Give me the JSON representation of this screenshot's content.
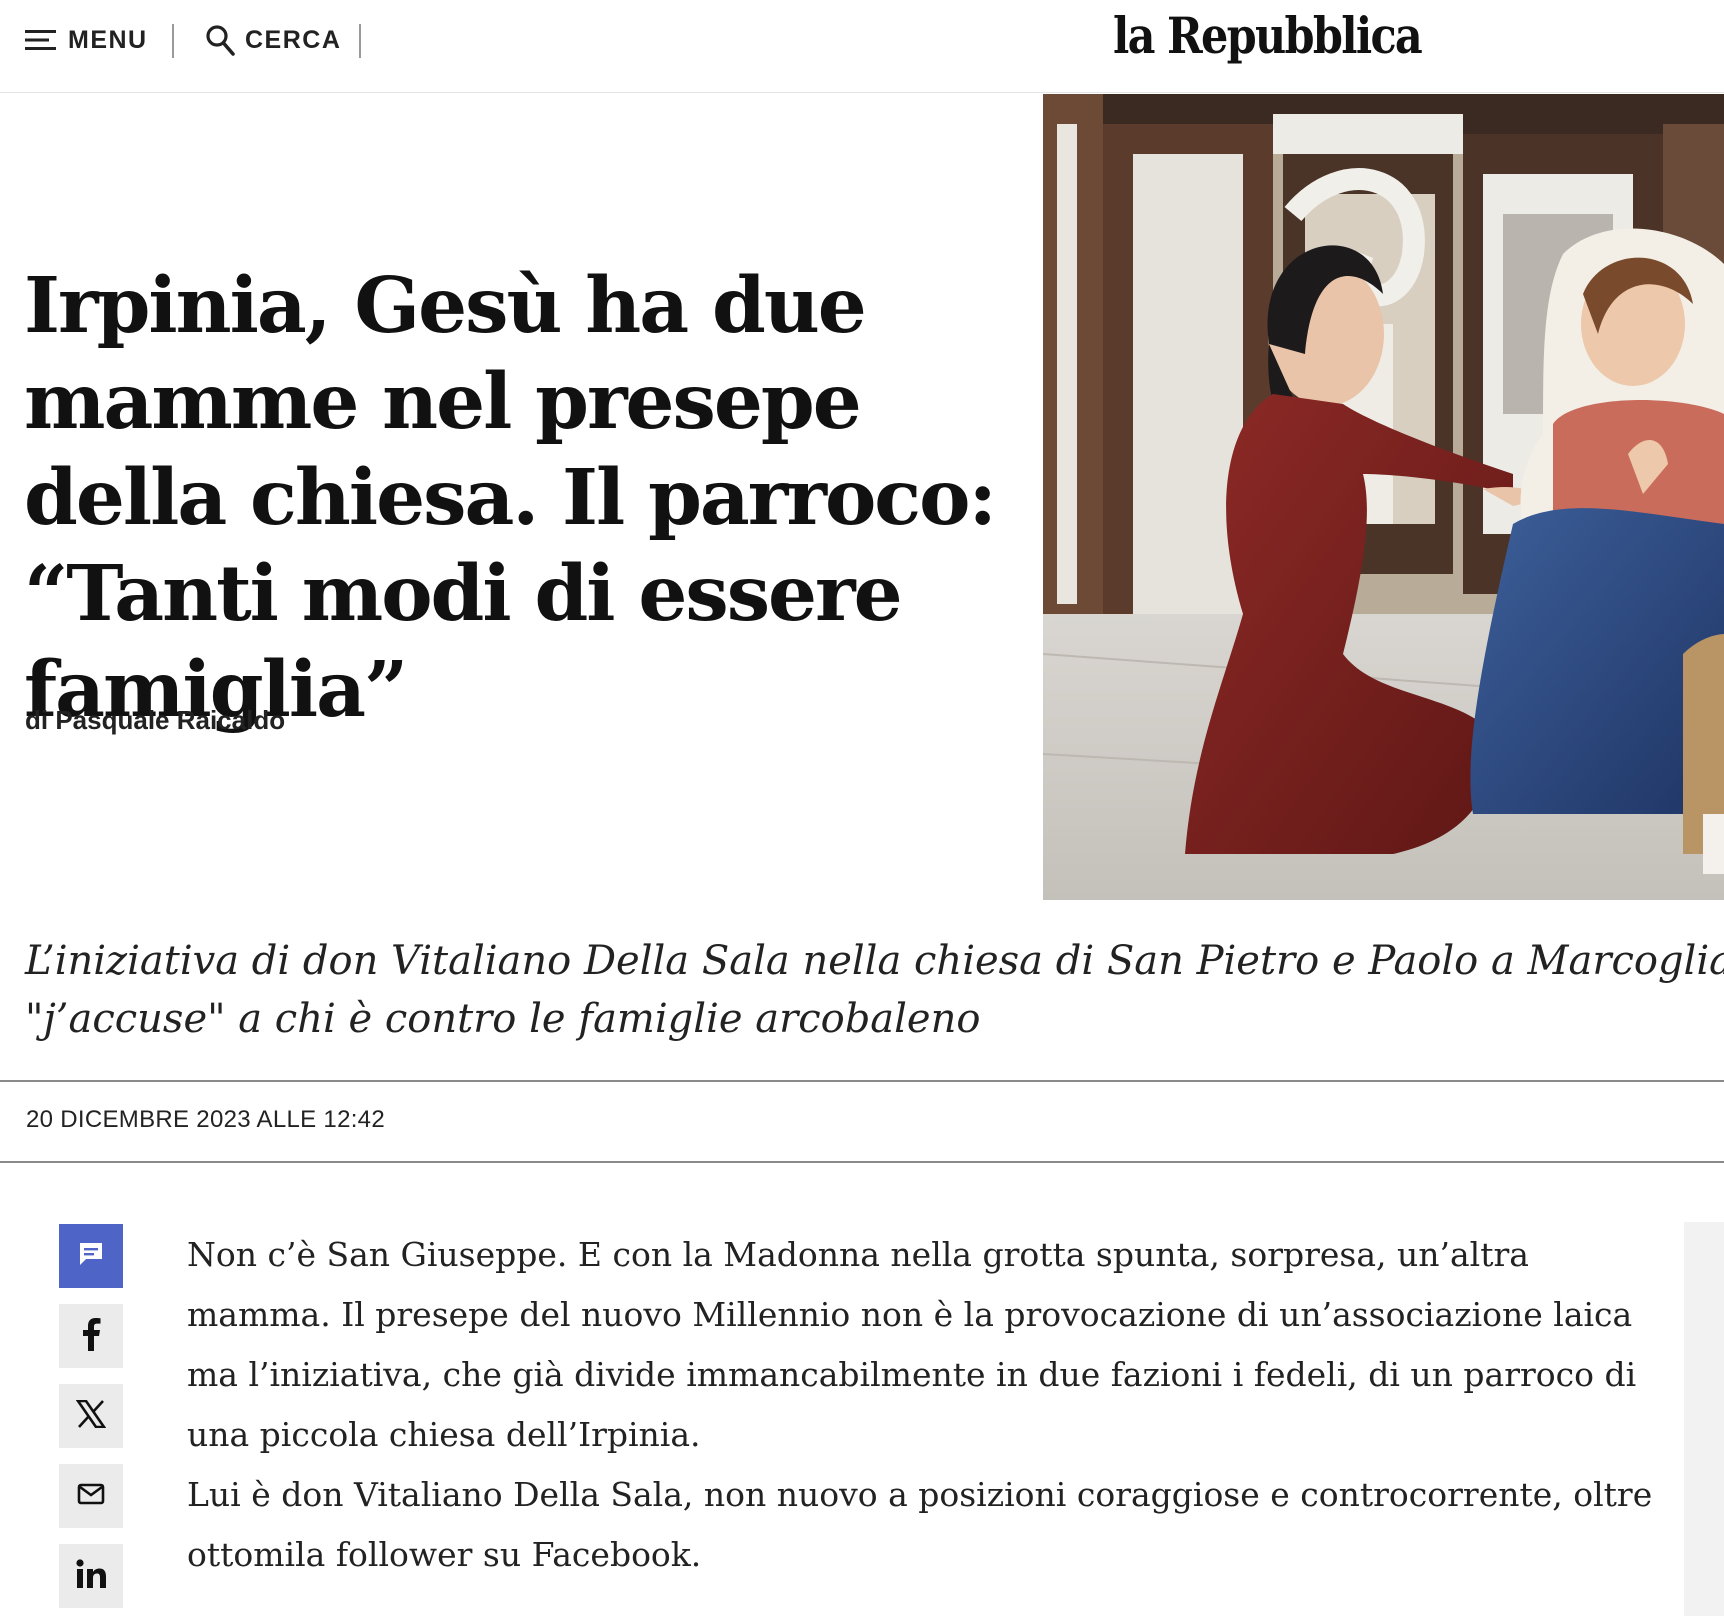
{
  "header": {
    "menu_label": "MENU",
    "search_label": "CERCA",
    "logo_text": "la Repubblica"
  },
  "article": {
    "headline": "Irpinia, Gesù ha due mamme nel presepe della chiesa. Il parroco: “Tanti modi di essere famiglia”",
    "byline": "di Pasquale Raicaldo",
    "summary_line1": "L’iniziativa di don Vitaliano Della Sala nella chiesa di San Pietro e Paolo a Marcoglia",
    "summary_line2": "\"j’accuse\" a chi è contro le famiglie arcobaleno",
    "date": "20 DICEMBRE 2023 ALLE 12:42",
    "paragraph1": {
      "line1": "Non c’è San Giuseppe. E con la Madonna nella grotta spunta, sorpresa, un’altra",
      "line2": "mamma. Il presepe del nuovo Millennio non è la provocazione di un’associazione laica",
      "line3": "ma l’iniziativa, che già divide immancabilmente in due fazioni i fedeli, di un parroco di",
      "line4": "una piccola chiesa dell’Irpinia."
    },
    "paragraph2": {
      "line1": "Lui è don Vitaliano Della Sala, non nuovo a posizioni coraggiose e controcorrente, oltre",
      "line2": "ottomila follower su Facebook."
    }
  },
  "share": {
    "items": [
      "comments-icon",
      "facebook-icon",
      "x-icon",
      "email-icon",
      "linkedin-icon"
    ],
    "comments_color": "#4e64c7"
  }
}
